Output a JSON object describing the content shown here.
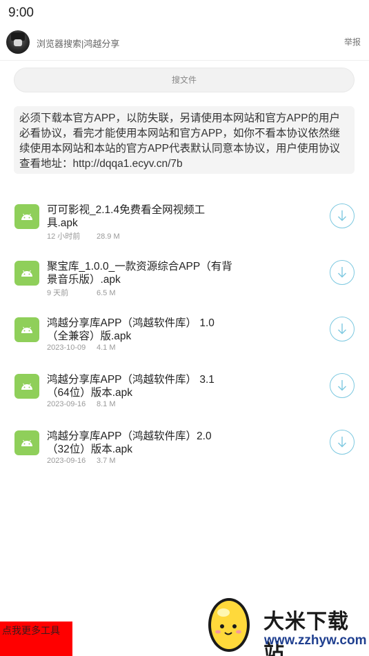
{
  "status_bar": {
    "time": "9:00"
  },
  "header": {
    "title": "浏览器搜索|鸿越分享",
    "report": "举报"
  },
  "search": {
    "label": "搜文件"
  },
  "notice": {
    "text": "必须下载本官方APP，以防失联，另请使用本网站和官方APP的用户必看协议，看完才能使用本网站和官方APP，如你不看本协议依然继续使用本网站和本站的官方APP代表默认同意本协议，用户使用协议查看地址：http://dqqa1.ecyv.cn/7b"
  },
  "files": [
    {
      "name": "可可影视_2.1.4免费看全网视频工具.apk",
      "time": "12 小时前",
      "size": "28.9 M"
    },
    {
      "name": "聚宝库_1.0.0_一款资源综合APP（有背景音乐版）.apk",
      "time": "9 天前",
      "size": "6.5 M"
    },
    {
      "name": "鸿越分享库APP（鸿越软件库） 1.0（全兼容）版.apk",
      "time": "2023-10-09",
      "size": "4.1 M"
    },
    {
      "name": "鸿越分享库APP（鸿越软件库） 3.1（64位）版本.apk",
      "time": "2023-09-16",
      "size": "8.1 M"
    },
    {
      "name": "鸿越分享库APP（鸿越软件库）2.0（32位）版本.apk",
      "time": "2023-09-16",
      "size": "3.7 M"
    }
  ],
  "more_tools": {
    "label": "点我更多工具"
  },
  "watermark": {
    "title": "大米下载站",
    "url": "www.zzhyw.com"
  },
  "colors": {
    "android_green": "#8fcf5a",
    "download_blue": "#7cc8e0",
    "more_tools_red": "#ff0000"
  },
  "icons": {
    "file": "android-icon",
    "download": "download-icon"
  }
}
